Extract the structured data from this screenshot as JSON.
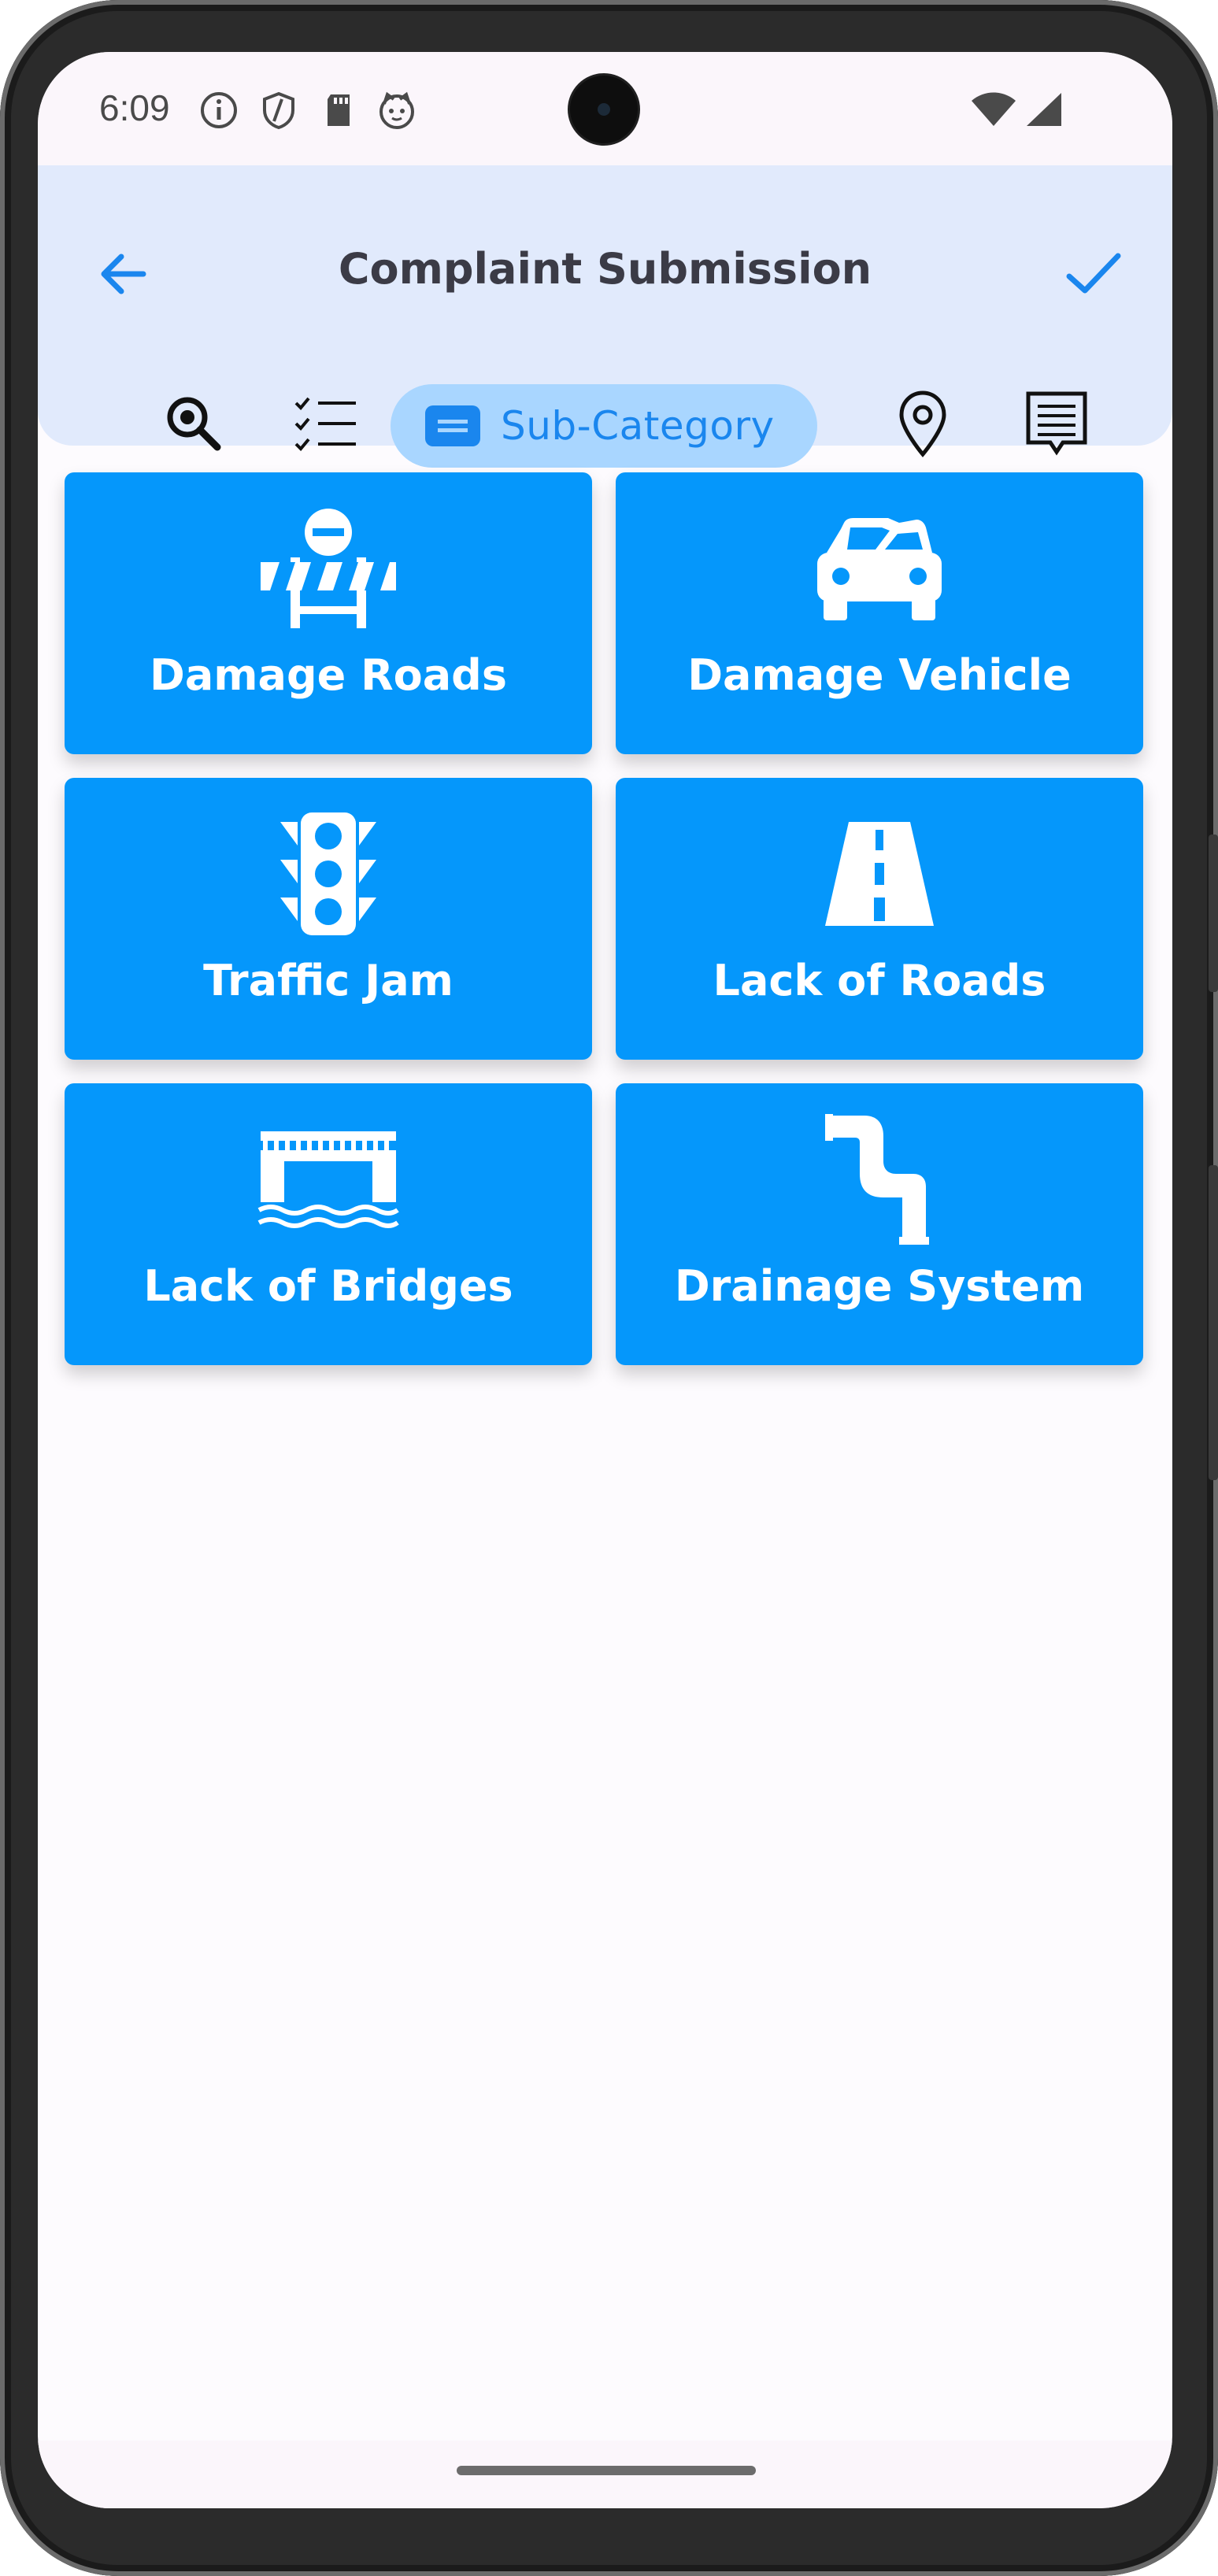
{
  "status_bar": {
    "time": "6:09",
    "icons": [
      "info-icon",
      "shield-icon",
      "sd-card-icon",
      "cat-face-icon"
    ],
    "right_icons": [
      "wifi-icon",
      "cellular-signal-icon"
    ]
  },
  "header": {
    "title": "Complaint Submission",
    "back_icon": "arrow-left-icon",
    "confirm_icon": "checkmark-icon",
    "accent_color": "#1a86ee",
    "background_color": "#e1eafc"
  },
  "steps": [
    {
      "icon": "search-zoom-icon",
      "label": "",
      "active": false
    },
    {
      "icon": "checklist-icon",
      "label": "",
      "active": false
    },
    {
      "icon": "ticket-card-icon",
      "label": "Sub-Category",
      "active": true
    },
    {
      "icon": "location-pin-icon",
      "label": "",
      "active": false
    },
    {
      "icon": "receipt-list-icon",
      "label": "",
      "active": false
    }
  ],
  "subcategories": [
    {
      "label": "Damage Roads",
      "icon": "road-barrier-icon"
    },
    {
      "label": "Damage Vehicle",
      "icon": "crashed-car-icon"
    },
    {
      "label": "Traffic Jam",
      "icon": "traffic-light-icon"
    },
    {
      "label": "Lack of Roads",
      "icon": "road-icon"
    },
    {
      "label": "Lack of Bridges",
      "icon": "bridge-icon"
    },
    {
      "label": "Drainage System",
      "icon": "pipe-icon"
    }
  ],
  "card_color": "#0597fb"
}
